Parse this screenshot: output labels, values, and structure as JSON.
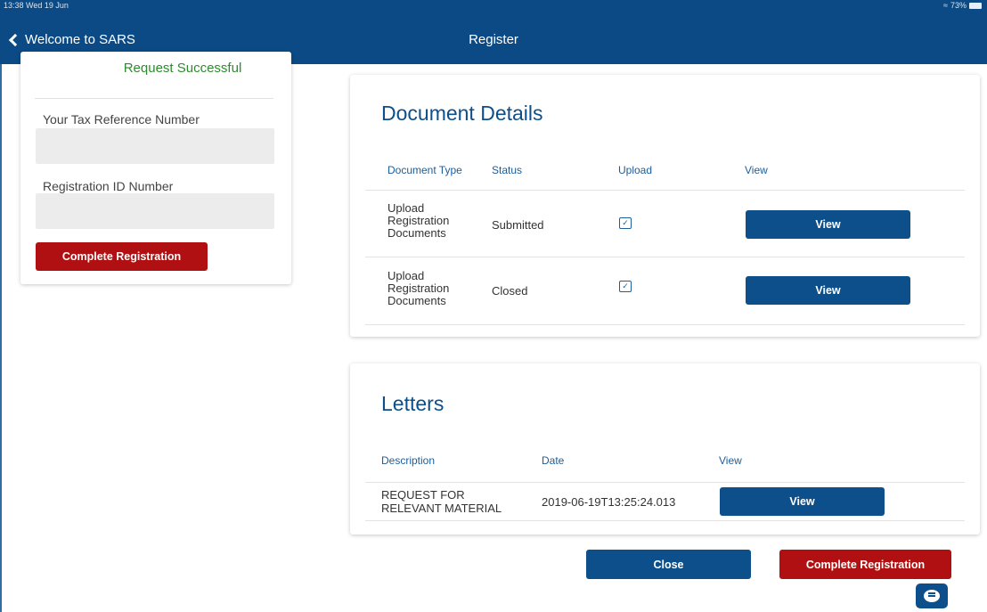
{
  "status_bar": {
    "time": "13:38  Wed 19 Jun",
    "battery": "73%"
  },
  "nav": {
    "back_label": "Welcome to SARS",
    "title": "Register"
  },
  "left_panel": {
    "success_message": "Request Successful",
    "tax_ref_label": "Your Tax Reference Number",
    "tax_ref_value": "",
    "reg_id_label": "Registration ID Number",
    "reg_id_value": "",
    "complete_button": "Complete Registration"
  },
  "documents": {
    "title": "Document Details",
    "headers": {
      "type": "Document Type",
      "status": "Status",
      "upload": "Upload",
      "view": "View"
    },
    "rows": [
      {
        "type": "Upload Registration Documents",
        "status": "Submitted",
        "view_label": "View"
      },
      {
        "type": "Upload Registration Documents",
        "status": "Closed",
        "view_label": "View"
      }
    ]
  },
  "letters": {
    "title": "Letters",
    "headers": {
      "description": "Description",
      "date": "Date",
      "view": "View"
    },
    "rows": [
      {
        "description": "REQUEST FOR RELEVANT MATERIAL",
        "date": "2019-06-19T13:25:24.013",
        "view_label": "View"
      }
    ]
  },
  "footer": {
    "close_button": "Close",
    "complete_button": "Complete Registration"
  },
  "colors": {
    "brand_blue": "#0d4f8b",
    "brand_red": "#b01012",
    "success_green": "#2e8b2e"
  }
}
